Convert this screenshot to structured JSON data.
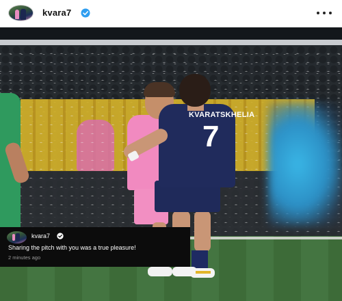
{
  "header": {
    "username": "kvara7",
    "verified_icon": "verified-badge-icon",
    "more_icon": "more-options-icon"
  },
  "photo": {
    "jersey_name": "KVARATSKHELIA",
    "jersey_number": "7"
  },
  "comment": {
    "username": "kvara7",
    "text": "Sharing the pitch with you was a true pleasure!",
    "timestamp": "2 minutes ago"
  },
  "colors": {
    "verified_blue": "#2f9ef0",
    "comment_bg": "#0c0c0c",
    "timestamp_gray": "#9a9a9a"
  }
}
